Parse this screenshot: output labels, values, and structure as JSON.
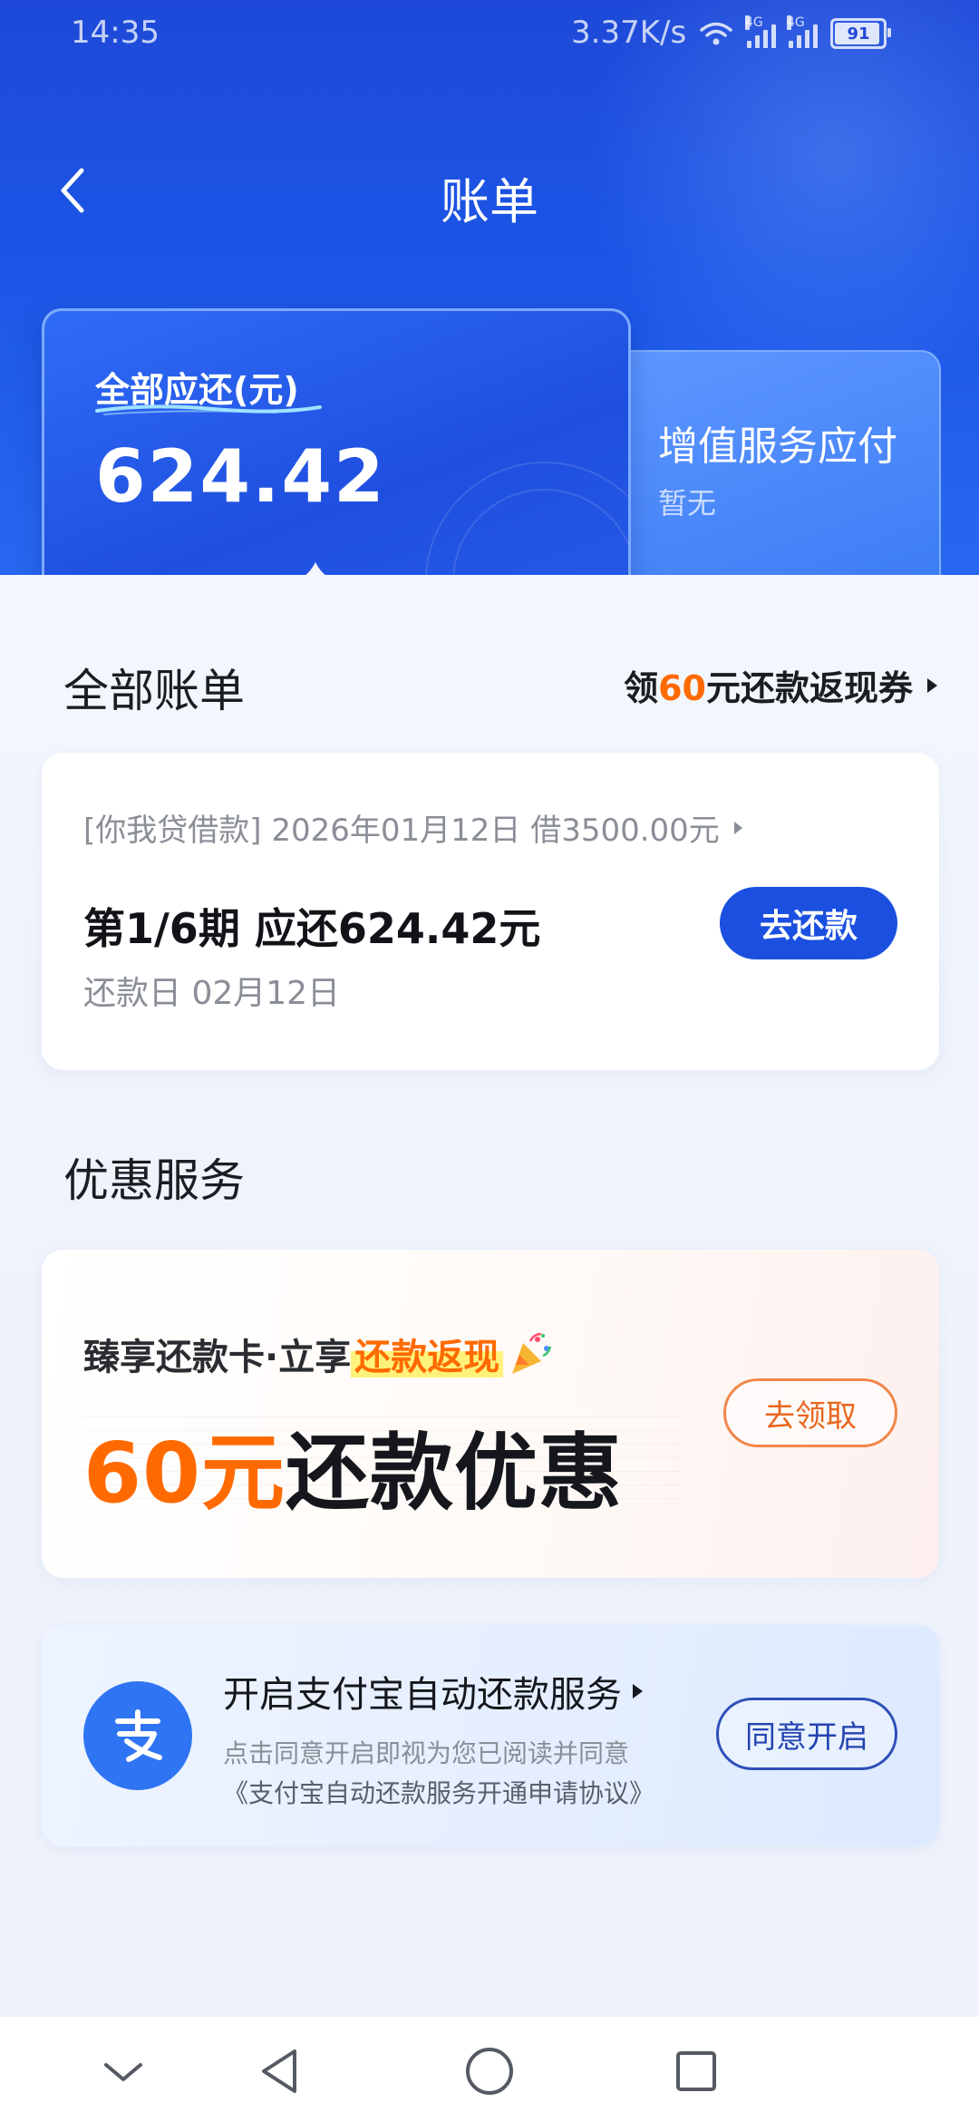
{
  "status_bar": {
    "time": "14:35",
    "speed": "3.37K/s",
    "network_label": "4G",
    "battery": "91"
  },
  "header": {
    "title": "账单"
  },
  "summary": {
    "main_label": "全部应还(元)",
    "main_amount": "624.42",
    "side_title": "增值服务应付",
    "side_sub": "暂无"
  },
  "bills_section": {
    "title": "全部账单",
    "coupon_prefix": "领",
    "coupon_amount": "60",
    "coupon_suffix": "元还款返现券"
  },
  "bill": {
    "loan_info": "[你我贷借款] 2026年01月12日 借3500.00元",
    "period": "第1/6期 应还624.42元",
    "due_date": "还款日 02月12日",
    "pay_button": "去还款"
  },
  "offers_section": {
    "title": "优惠服务"
  },
  "promo": {
    "tagline_prefix": "臻享还款卡·立享",
    "tagline_highlight": "还款返现",
    "amount_number": "60元",
    "amount_rest": "还款优惠",
    "claim_button": "去领取"
  },
  "auto_pay": {
    "logo_char": "支",
    "title": "开启支付宝自动还款服务",
    "desc_line1": "点击同意开启即视为您已阅读并同意",
    "desc_line2": "《支付宝自动还款服务开通申请协议》",
    "agree_button": "同意开启"
  },
  "colors": {
    "primary_blue": "#1a4fe0",
    "accent_orange": "#ff6a00",
    "header_blue": "#1e49d8"
  }
}
